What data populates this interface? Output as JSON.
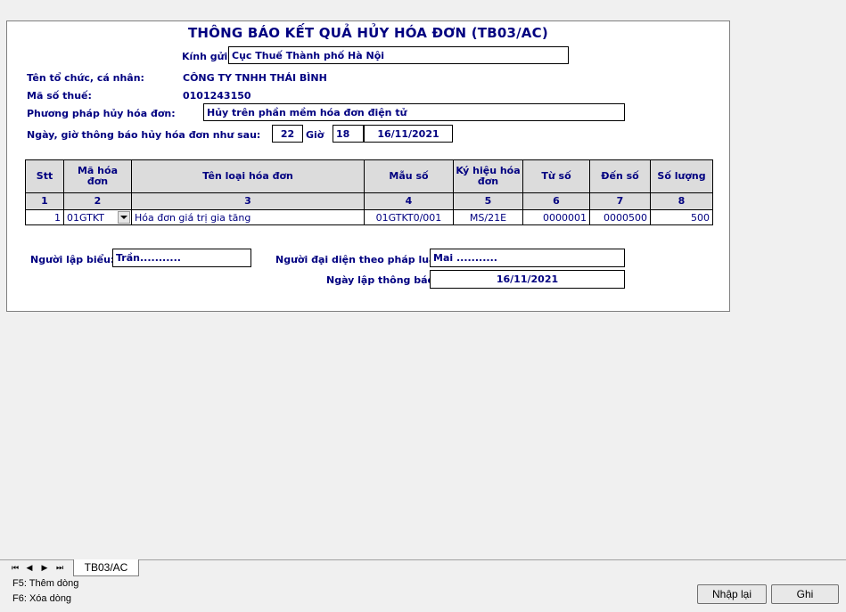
{
  "form": {
    "title": "THÔNG BÁO KẾT QUẢ HỦY HÓA ĐƠN (TB03/AC)",
    "kinh_gui_label": "Kính gửi:",
    "kinh_gui_value": "Cục Thuế Thành phố Hà Nội",
    "to_chuc_label": "Tên tổ chức, cá nhân:",
    "to_chuc_value": "CÔNG TY TNHH THÁI BÌNH",
    "mst_label": "Mã số thuế:",
    "mst_value": "0101243150",
    "phuong_phap_label": "Phương pháp hủy hóa đơn:",
    "phuong_phap_value": "Hủy trên phần mềm hóa đơn điện tử",
    "ngay_gio_label": "Ngày, giờ thông báo hủy hóa đơn như sau:",
    "gio_value": "22",
    "gio_label": "Giờ",
    "phut_value": "18",
    "ngay_value": "16/11/2021"
  },
  "table": {
    "headers": [
      "Stt",
      "Mã hóa đơn",
      "Tên loại hóa đơn",
      "Mẫu số",
      "Ký hiệu hóa đơn",
      "Từ số",
      "Đến số",
      "Số lượng"
    ],
    "numbers": [
      "1",
      "2",
      "3",
      "4",
      "5",
      "6",
      "7",
      "8"
    ],
    "rows": [
      {
        "stt": "1",
        "ma_hoa_don": "01GTKT",
        "ten_loai": "Hóa đơn giá trị gia tăng",
        "mau_so": "01GTKT0/001",
        "ky_hieu": "MS/21E",
        "tu_so": "0000001",
        "den_so": "0000500",
        "so_luong": "500"
      }
    ]
  },
  "footer_fields": {
    "nguoi_lap_label": "Người lập biểu:",
    "nguoi_lap_value": "Trần...........",
    "dai_dien_label": "Người đại diện theo pháp luật:",
    "dai_dien_value": "Mai ...........",
    "ngay_lap_label": "Ngày lập thông báo:",
    "ngay_lap_value": "16/11/2021"
  },
  "sheet_tab": "TB03/AC",
  "nav": {
    "first": "⏮",
    "prev": "◀",
    "next": "▶",
    "last": "⏭"
  },
  "hints": [
    "F5: Thêm dòng",
    "F6: Xóa dòng"
  ],
  "buttons": {
    "reset": "Nhập lại",
    "save": "Ghi"
  }
}
